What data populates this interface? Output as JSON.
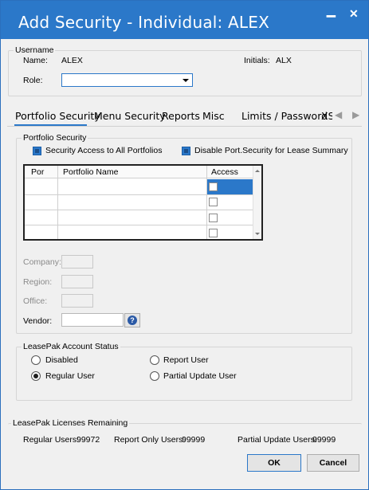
{
  "window": {
    "title": "Add Security - Individual: ALEX",
    "minimize_glyph": "▁",
    "close_glyph": "✕"
  },
  "username": {
    "legend": "Username",
    "name_label": "Name:",
    "name_value": "ALEX",
    "initials_label": "Initials:",
    "initials_value": "ALX",
    "role_label": "Role:",
    "role_value": ""
  },
  "tabs": [
    {
      "label": "Portfolio Security",
      "active": true
    },
    {
      "label": "Menu Security"
    },
    {
      "label": "Reports"
    },
    {
      "label": "Misc"
    },
    {
      "label": "Limits / Password"
    },
    {
      "label": "XS"
    }
  ],
  "tab_scroll": {
    "left": "◀",
    "right": "▶"
  },
  "portfolio_security": {
    "legend": "Portfolio Security",
    "access_all_label": "Security Access to All Portfolios",
    "disable_lease_label": "Disable Port.Security for Lease Summary",
    "grid": {
      "columns": [
        "Por",
        "Portfolio Name",
        "Access"
      ],
      "rows": [
        {
          "por": "",
          "name": "",
          "access": false
        },
        {
          "por": "",
          "name": "",
          "access": false
        },
        {
          "por": "",
          "name": "",
          "access": false
        },
        {
          "por": "",
          "name": "",
          "access": false
        }
      ]
    },
    "company_label": "Company:",
    "region_label": "Region:",
    "office_label": "Office:",
    "vendor_label": "Vendor:",
    "vendor_value": "",
    "help_glyph": "?"
  },
  "account_status": {
    "legend": "LeasePak Account Status",
    "options": [
      {
        "label": "Disabled",
        "selected": false
      },
      {
        "label": "Report User",
        "selected": false
      },
      {
        "label": "Regular User",
        "selected": true
      },
      {
        "label": "Partial Update User",
        "selected": false
      }
    ]
  },
  "licenses": {
    "legend": "LeasePak Licenses Remaining",
    "regular_label": "Regular Users:",
    "regular_value": "99972",
    "report_only_label": "Report Only Users:",
    "report_only_value": "99999",
    "partial_label": "Partial Update Users:",
    "partial_value": "99999"
  },
  "buttons": {
    "ok": "OK",
    "cancel": "Cancel"
  },
  "colors": {
    "accent": "#2b78c9",
    "title_bar": "#2b78c9"
  }
}
